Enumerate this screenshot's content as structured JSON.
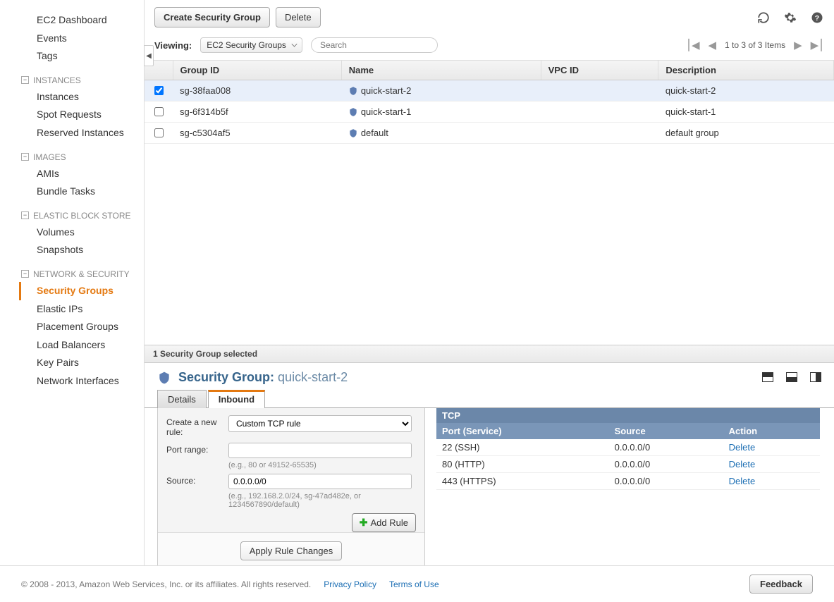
{
  "sidebar": {
    "top": [
      "EC2 Dashboard",
      "Events",
      "Tags"
    ],
    "sections": [
      {
        "title": "INSTANCES",
        "items": [
          "Instances",
          "Spot Requests",
          "Reserved Instances"
        ]
      },
      {
        "title": "IMAGES",
        "items": [
          "AMIs",
          "Bundle Tasks"
        ]
      },
      {
        "title": "ELASTIC BLOCK STORE",
        "items": [
          "Volumes",
          "Snapshots"
        ]
      },
      {
        "title": "NETWORK & SECURITY",
        "items": [
          "Security Groups",
          "Elastic IPs",
          "Placement Groups",
          "Load Balancers",
          "Key Pairs",
          "Network Interfaces"
        ],
        "active": "Security Groups"
      }
    ]
  },
  "toolbar": {
    "create": "Create Security Group",
    "delete": "Delete"
  },
  "filter": {
    "viewing_label": "Viewing:",
    "viewing_value": "EC2 Security Groups",
    "search_placeholder": "Search"
  },
  "pager": {
    "text": "1 to 3 of 3 Items"
  },
  "table": {
    "headers": {
      "group_id": "Group ID",
      "name": "Name",
      "vpc_id": "VPC ID",
      "description": "Description"
    },
    "rows": [
      {
        "checked": true,
        "group_id": "sg-38faa008",
        "name": "quick-start-2",
        "vpc_id": "",
        "description": "quick-start-2"
      },
      {
        "checked": false,
        "group_id": "sg-6f314b5f",
        "name": "quick-start-1",
        "vpc_id": "",
        "description": "quick-start-1"
      },
      {
        "checked": false,
        "group_id": "sg-c5304af5",
        "name": "default",
        "vpc_id": "",
        "description": "default group"
      }
    ]
  },
  "details": {
    "selection_text": "1 Security Group selected",
    "title_label": "Security Group:",
    "title_value": "quick-start-2",
    "tabs": {
      "details": "Details",
      "inbound": "Inbound"
    },
    "form": {
      "create_rule_label": "Create a new rule:",
      "rule_type_value": "Custom TCP rule",
      "port_range_label": "Port range:",
      "port_range_hint": "(e.g., 80 or 49152-65535)",
      "source_label": "Source:",
      "source_value": "0.0.0.0/0",
      "source_hint": "(e.g., 192.168.2.0/24, sg-47ad482e, or 1234567890/default)",
      "add_rule": "Add Rule",
      "apply": "Apply Rule Changes"
    },
    "rules": {
      "protocol": "TCP",
      "headers": {
        "port": "Port (Service)",
        "source": "Source",
        "action": "Action"
      },
      "rows": [
        {
          "port": "22 (SSH)",
          "source": "0.0.0.0/0",
          "action": "Delete"
        },
        {
          "port": "80 (HTTP)",
          "source": "0.0.0.0/0",
          "action": "Delete"
        },
        {
          "port": "443 (HTTPS)",
          "source": "0.0.0.0/0",
          "action": "Delete"
        }
      ]
    }
  },
  "footer": {
    "copyright": "© 2008 - 2013, Amazon Web Services, Inc. or its affiliates. All rights reserved.",
    "privacy": "Privacy Policy",
    "terms": "Terms of Use",
    "feedback": "Feedback"
  }
}
